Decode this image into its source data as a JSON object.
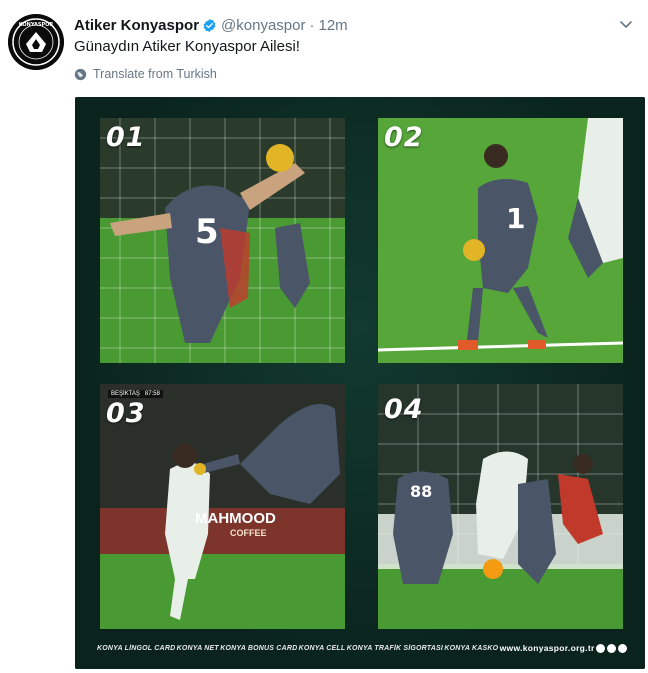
{
  "tweet": {
    "display_name": "Atiker Konyaspor",
    "handle": "@konyaspor",
    "separator": "·",
    "time": "12m",
    "text": "Günaydın Atiker Konyaspor Ailesi!",
    "translate_label": "Translate from Turkish"
  },
  "avatar": {
    "logo_text": "KONYASPOR"
  },
  "media": {
    "panels": [
      {
        "number": "01"
      },
      {
        "number": "02"
      },
      {
        "number": "03",
        "scoreboard": "BEŞİKTAŞ",
        "clock": "87:58",
        "banner_text": "MAHMOOD",
        "banner_sub": "COFFEE"
      },
      {
        "number": "04",
        "jersey": "88"
      }
    ],
    "sponsors": [
      "KONYA LİNGOL CARD",
      "KONYA NET",
      "KONYA BONUS CARD",
      "KONYA CELL",
      "KONYA TRAFİK SİGORTASI",
      "KONYA KASKO"
    ],
    "website": "www.konyaspor.org.tr"
  },
  "colors": {
    "verified": "#1da1f2",
    "media_bg": "#0c2a23",
    "muted": "#657786"
  },
  "icons": [
    "verified-badge-icon",
    "chevron-down-icon",
    "globe-icon"
  ]
}
